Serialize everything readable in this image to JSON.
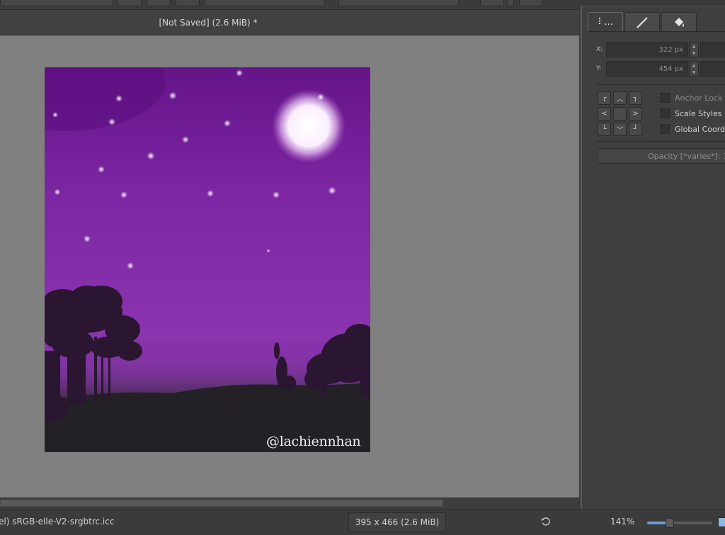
{
  "document": {
    "title": "[Not Saved]  (2.6 MiB) *"
  },
  "canvas": {
    "watermark": "@lachiennhan",
    "zoom_percent": 141
  },
  "docker": {
    "tabs": [
      "⠇...",
      "line-tool",
      "fill-tool"
    ],
    "x_label": "X:",
    "x_value": "322 px",
    "y_label": "Y:",
    "y_value": "454 px",
    "anchor_lock": "Anchor Lock",
    "scale_styles": "Scale Styles",
    "global_coordinates": "Global Coordin",
    "opacity": "Opacity [*varies*]: 1"
  },
  "status": {
    "profile": "el)  sRGB-elle-V2-srgbtrc.icc",
    "image_size": "395 x 466 (2.6 MiB)",
    "zoom": "141%"
  },
  "colors": {
    "canvas_bg": "#808080",
    "sky_top": "#6a1a8e",
    "sky_mid": "#8a33ad",
    "ground": "#232126",
    "accent": "#6b9bd1"
  }
}
